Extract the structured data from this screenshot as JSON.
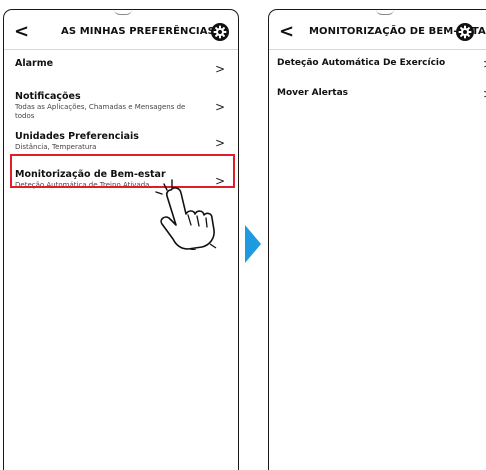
{
  "left_screen": {
    "title": "AS MINHAS PREFERÊNCIAS",
    "back_glyph": "<",
    "settings_icon": "gear-icon",
    "items": [
      {
        "title": "Alarme",
        "subtitle": ""
      },
      {
        "title": "Notificações",
        "subtitle": "Todas as Aplicações, Chamadas e Mensagens de todos"
      },
      {
        "title": "Unidades Preferenciais",
        "subtitle": "Distância, Temperatura"
      },
      {
        "title": "Monitorização de Bem-estar",
        "subtitle": "Deteção Automática de Treino Ativada"
      }
    ],
    "chevron": ">"
  },
  "right_screen": {
    "title": "MONITORIZAÇÃO DE BEM-ESTAR",
    "back_glyph": "<",
    "settings_icon": "gear-icon",
    "items": [
      {
        "title": "Deteção Automática De Exercício"
      },
      {
        "title": "Mover Alertas"
      }
    ],
    "chevron": ">"
  },
  "annotations": {
    "highlight_color": "#e01e2a",
    "arrow_color": "#1e9be0",
    "hand_icon": "tap-hand-icon",
    "arrow_icon": "next-step-arrow-icon"
  }
}
